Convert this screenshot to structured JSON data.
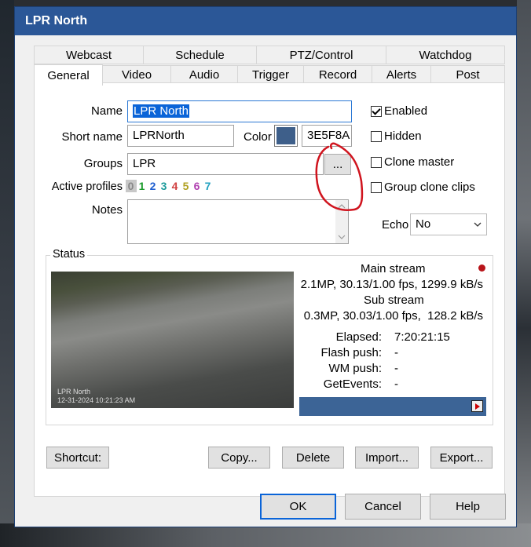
{
  "window": {
    "title": "LPR North"
  },
  "tabs_row1": [
    "Webcast",
    "Schedule",
    "PTZ/Control",
    "Watchdog"
  ],
  "tabs_row2": [
    "General",
    "Video",
    "Audio",
    "Trigger",
    "Record",
    "Alerts",
    "Post"
  ],
  "form": {
    "name_label": "Name",
    "name_value": "LPR North",
    "short_name_label": "Short name",
    "short_name_value": "LPRNorth",
    "color_label": "Color",
    "color_value": "3E5F8A",
    "color_swatch": "#3e5f8a",
    "groups_label": "Groups",
    "groups_value": "LPR",
    "groups_button": "...",
    "profiles_label": "Active profiles",
    "profiles": [
      "0",
      "1",
      "2",
      "3",
      "4",
      "5",
      "6",
      "7"
    ],
    "profile_colors": [
      "#888888",
      "#1a9a2a",
      "#1f5fd0",
      "#1a9a9a",
      "#d04040",
      "#b0a020",
      "#b040b0",
      "#20a0c0"
    ],
    "notes_label": "Notes",
    "notes_value": "",
    "enabled_label": "Enabled",
    "hidden_label": "Hidden",
    "clone_master_label": "Clone master",
    "group_clone_label": "Group clone clips",
    "echo_label": "Echo",
    "echo_value": "No"
  },
  "status": {
    "label": "Status",
    "main_stream_label": "Main stream",
    "main_stream_value": "2.1MP, 30.13/1.00 fps, 1299.9 kB/s",
    "sub_stream_label": "Sub stream",
    "sub_stream_value": "0.3MP, 30.03/1.00 fps,  128.2 kB/s",
    "elapsed_label": "Elapsed:",
    "elapsed_value": "7:20:21:15",
    "flash_push_label": "Flash push:",
    "flash_push_value": "-",
    "wm_push_label": "WM push:",
    "wm_push_value": "-",
    "getevents_label": "GetEvents:",
    "getevents_value": "-",
    "video_overlay_name": "LPR North",
    "video_overlay_time": "12-31-2024 10:21:23 AM",
    "indicator_color": "#b8141a"
  },
  "buttons": {
    "shortcut": "Shortcut:",
    "copy": "Copy...",
    "delete": "Delete",
    "import": "Import...",
    "export": "Export...",
    "ok": "OK",
    "cancel": "Cancel",
    "help": "Help"
  },
  "annotation": {
    "color": "#d0141e"
  }
}
